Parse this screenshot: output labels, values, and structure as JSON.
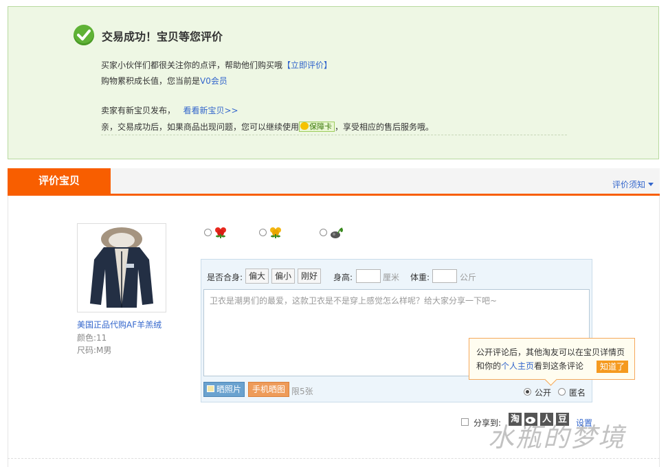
{
  "banner": {
    "title": "交易成功！宝贝等您评价",
    "line1_text": "买家小伙伴们都很关注你的点评，帮助他们购买哦",
    "line1_link": "立即评价",
    "line2_text": "购物累积成长值，您当前是",
    "line2_link": "V0会员",
    "line3_text": "卖家有新宝贝发布，",
    "line3_link": "看看新宝贝>>",
    "line4_prefix": "亲，交易成功后，如果商品出现问题，您可以继续使用",
    "line4_badge": "保障卡",
    "line4_suffix": "，享受相应的售后服务哦。"
  },
  "review": {
    "tab_label": "评价宝贝",
    "notice_link": "评价须知"
  },
  "product": {
    "name": "美国正品代购AF羊羔绒",
    "color": "颜色:11",
    "size": "尺码:M男"
  },
  "form": {
    "fit_label": "是否合身:",
    "fit_options": [
      "偏大",
      "偏小",
      "刚好"
    ],
    "height_label": "身高:",
    "height_unit": "厘米",
    "weight_label": "体重:",
    "weight_unit": "公斤",
    "textarea_placeholder": "卫衣是潮男们的最爱，这款卫衣是不是穿上感觉怎么样呢？给大家分享一下吧~",
    "photo_button": "晒照片",
    "phone_button": "手机晒图",
    "limit_text": "限5张",
    "public_label": "公开",
    "anonymous_label": "匿名"
  },
  "tooltip": {
    "text1": "公开评论后，其他淘友可以在宝贝详情页",
    "text2_prefix": "和你的",
    "text2_link": "个人主页",
    "text2_suffix": "看到这条评论",
    "button": "知道了"
  },
  "share": {
    "label": "分享到:",
    "icons": [
      "淘",
      "人",
      "豆"
    ],
    "settings_link": "设置"
  },
  "watermark": "水瓶的梦境",
  "colors": {
    "accent": "#f85e00",
    "success_bg": "#eef7e4",
    "link": "#3366cc"
  }
}
